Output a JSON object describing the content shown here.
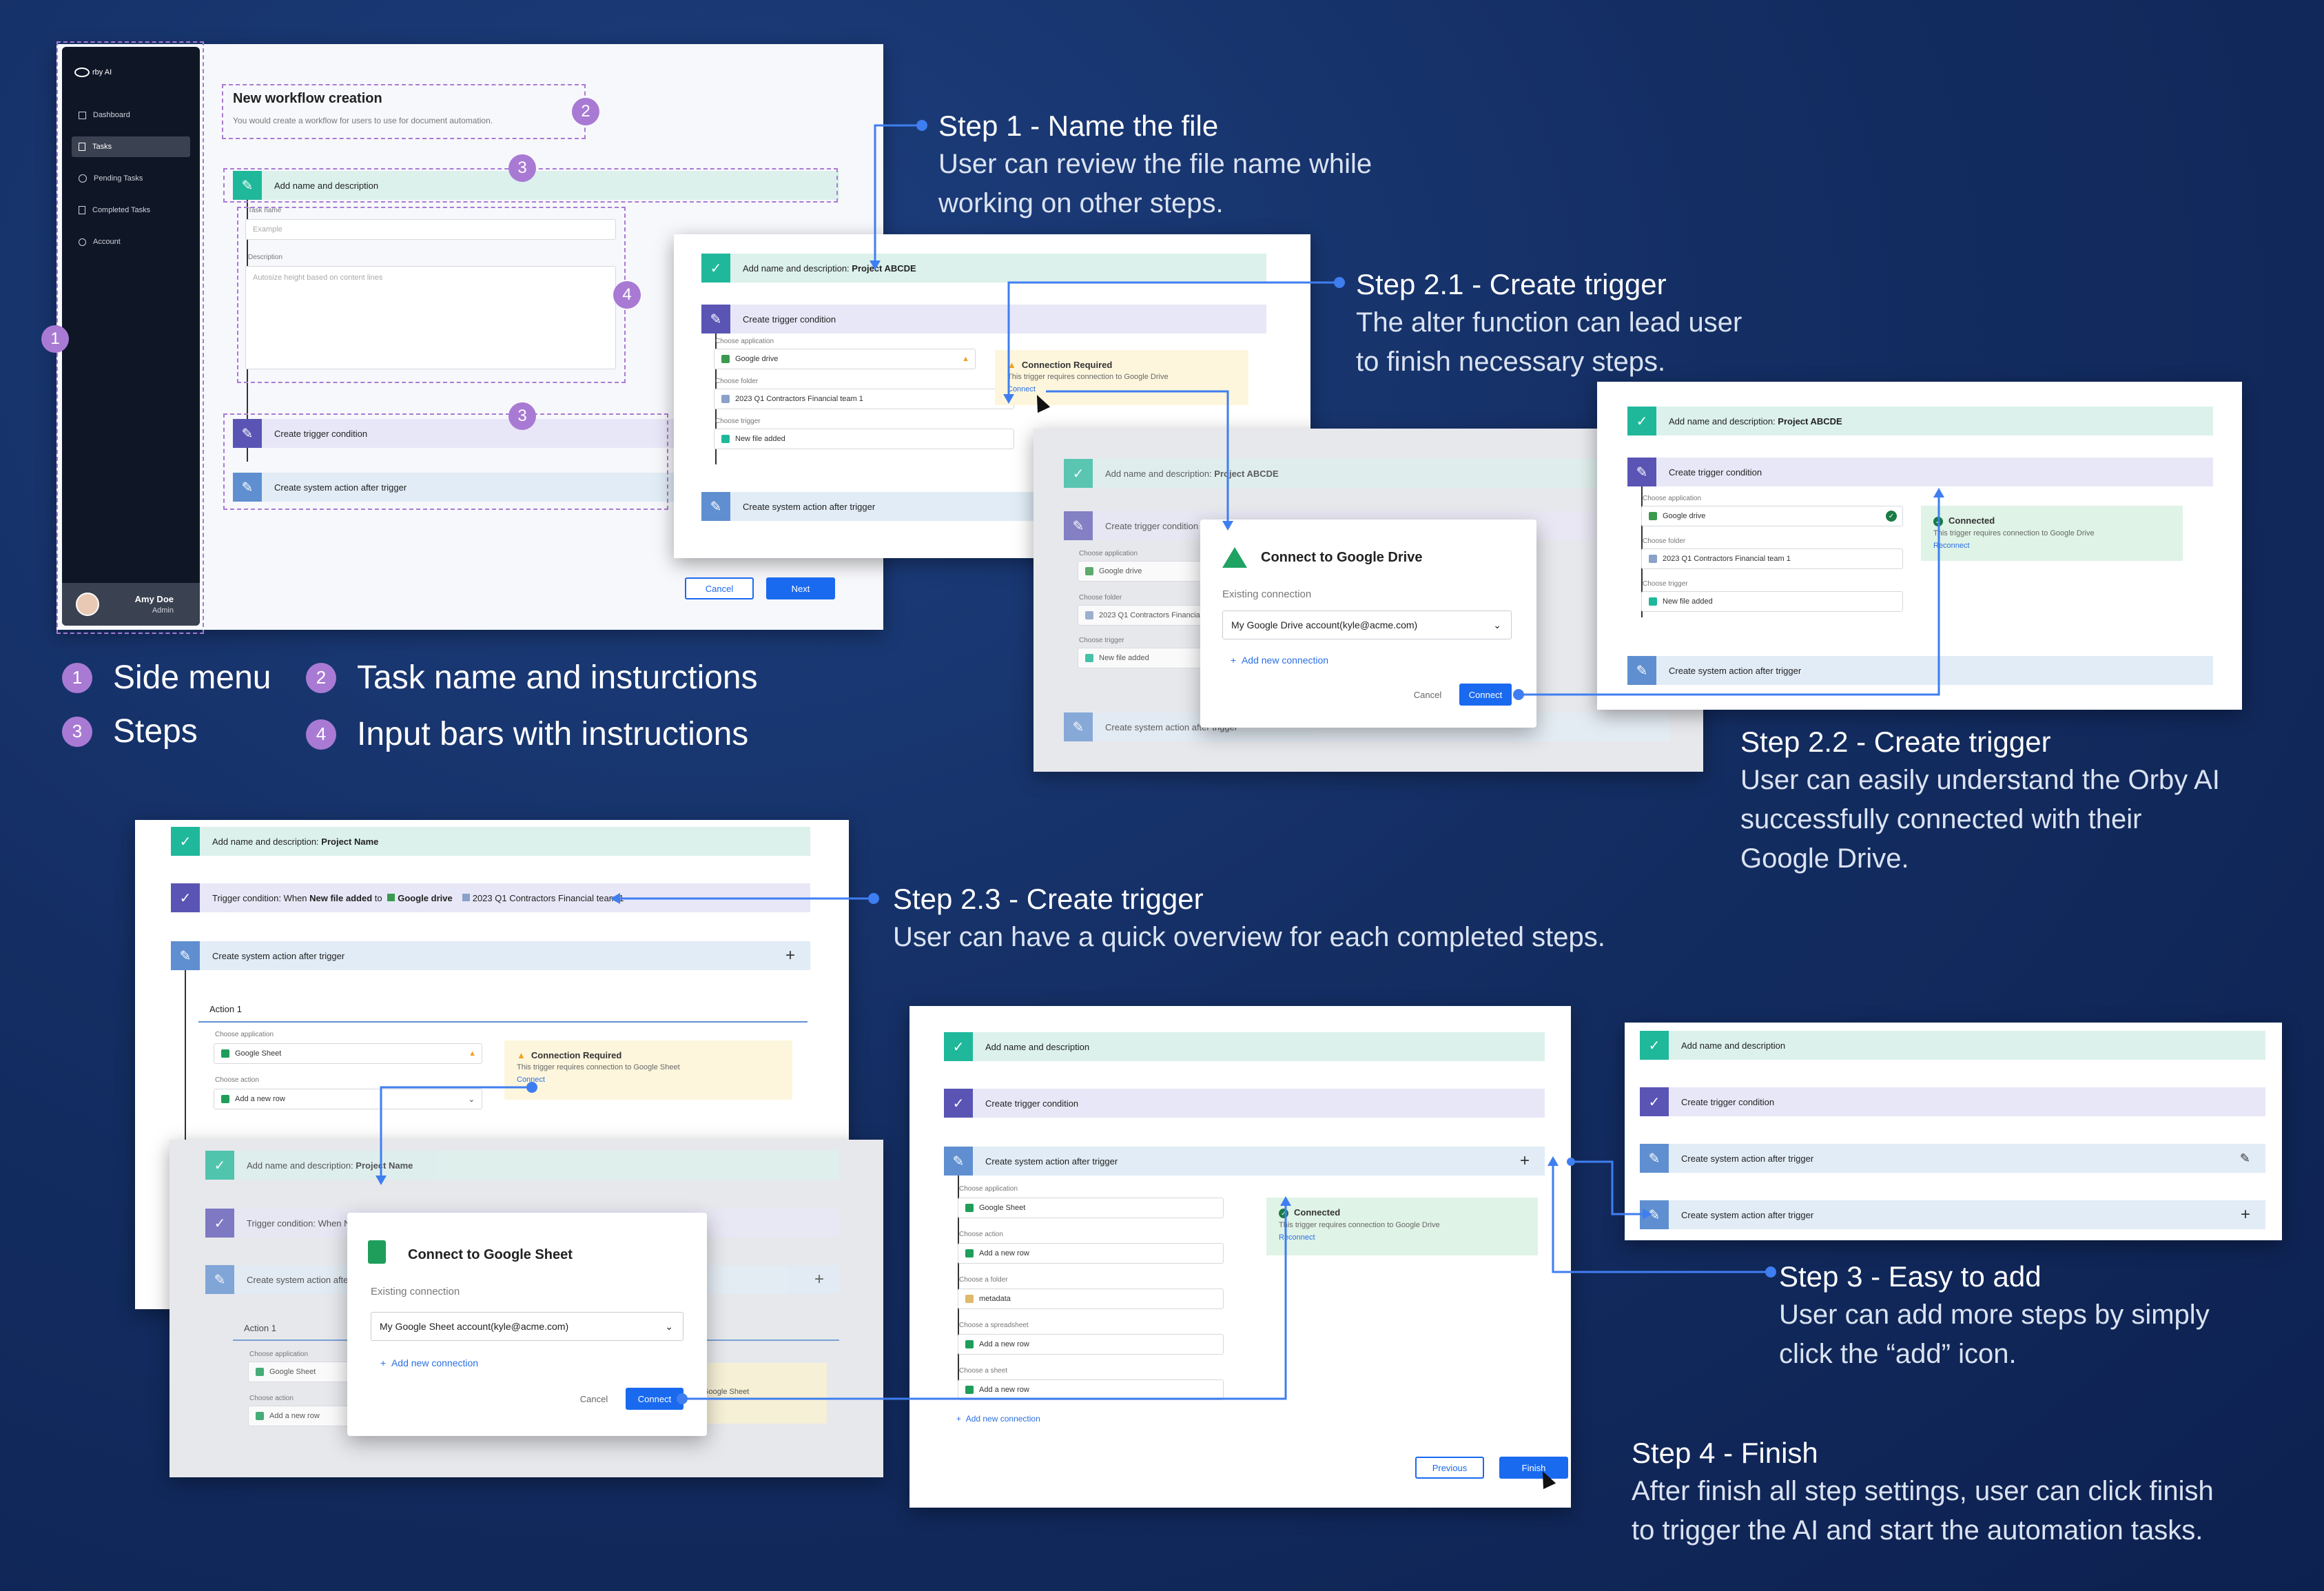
{
  "colors": {
    "background": "#142e63",
    "accent_purple": "#a97ad4",
    "link_blue": "#2b6fe3",
    "primary_button": "#1a6af0",
    "step_done": "#1fb89a",
    "step_trigger": "#5a55b4",
    "step_action": "#5f8fd0"
  },
  "sidebar": {
    "logo": "rby AI",
    "items": [
      {
        "label": "Dashboard",
        "icon": "dashboard-icon"
      },
      {
        "label": "Tasks",
        "icon": "document-icon"
      },
      {
        "label": "Pending Tasks",
        "icon": "clock-icon"
      },
      {
        "label": "Completed Tasks",
        "icon": "document-check-icon"
      },
      {
        "label": "Account",
        "icon": "user-icon"
      }
    ],
    "user": {
      "name": "Amy Doe",
      "role": "Admin"
    }
  },
  "main": {
    "title": "New workflow creation",
    "subtitle": "You would create a workflow for users to use for document automation.",
    "step_add": "Add name and description",
    "task_name_label": "Task name",
    "task_name_placeholder": "Example",
    "description_label": "Description",
    "description_placeholder": "Autosize height based on content lines",
    "step_trigger": "Create trigger condition",
    "step_action": "Create system action after trigger",
    "cancel": "Cancel",
    "next": "Next"
  },
  "badges": {
    "b1": "1",
    "b2": "2",
    "b3": "3",
    "b4": "4"
  },
  "legend": {
    "i1": "Side menu",
    "i2": "Task name and insturctions",
    "i3": "Steps",
    "i4": "Input bars with instructions"
  },
  "common": {
    "add_prefix": "Add name and description: ",
    "add_plain": "Add name and description",
    "project_abcde": "Project ABCDE",
    "project_name": "Project Name",
    "trigger": "Create trigger condition",
    "action": "Create system action after trigger",
    "choose_application": "Choose application",
    "choose_folder": "Choose folder",
    "choose_trigger": "Choose trigger",
    "choose_action": "Choose action",
    "choose_a_folder": "Choose a folder",
    "choose_spreadsheet": "Choose a spreadsheet",
    "choose_sheet": "Choose a sheet",
    "google_drive": "Google drive",
    "google_sheet": "Google Sheet",
    "folder_value": "2023 Q1 Contractors Financial team 1",
    "trigger_value": "New file added",
    "add_row": "Add a new row",
    "metadata": "metadata",
    "conn_required": "Connection Required",
    "conn_drive_msg": "This trigger requires connection to Google Drive",
    "conn_sheet_msg": "This trigger requires connection to Google Sheet",
    "connect": "Connect",
    "connected": "Connected",
    "reconnect": "Reconnect",
    "action1": "Action 1",
    "trigger_summary_prefix": "Trigger condition: When ",
    "trigger_summary_bold": "New file added",
    "trigger_summary_mid": " to ",
    "trigger_summary_short": "Trigger condition: When N",
    "add_new_connection": "Add new connection",
    "cancel": "Cancel",
    "previous": "Previous",
    "finish": "Finish"
  },
  "dialog_drive": {
    "title": "Connect to Google Drive",
    "existing": "Existing connection",
    "account": "My Google Drive account(kyle@acme.com)",
    "add": "Add new connection",
    "cancel": "Cancel",
    "connect": "Connect"
  },
  "dialog_sheet": {
    "title": "Connect to Google Sheet",
    "existing": "Existing connection",
    "account": "My Google Sheet account(kyle@acme.com)",
    "add": "Add new connection",
    "cancel": "Cancel",
    "connect": "Connect"
  },
  "annotations": {
    "step1_title": "Step 1 - Name the file",
    "step1_desc1": "User can review the file name while",
    "step1_desc2": "working on other steps.",
    "step21_title": "Step 2.1 - Create trigger",
    "step21_desc1": "The alter function can lead user",
    "step21_desc2": "to finish necessary steps.",
    "step22_title": "Step 2.2 - Create trigger",
    "step22_desc1": "User can easily understand the Orby AI",
    "step22_desc2": "successfully connected with their",
    "step22_desc3": "Google Drive.",
    "step23_title": "Step 2.3 - Create trigger",
    "step23_desc1": "User can have a quick overview for each completed steps.",
    "step3_title": "Step 3 - Easy to add",
    "step3_desc1": "User can add more steps by simply",
    "step3_desc2": "click the “add” icon.",
    "step4_title": "Step 4 - Finish",
    "step4_desc1": "After finish all step settings, user can click finish",
    "step4_desc2": "to trigger the AI and start the automation tasks."
  }
}
